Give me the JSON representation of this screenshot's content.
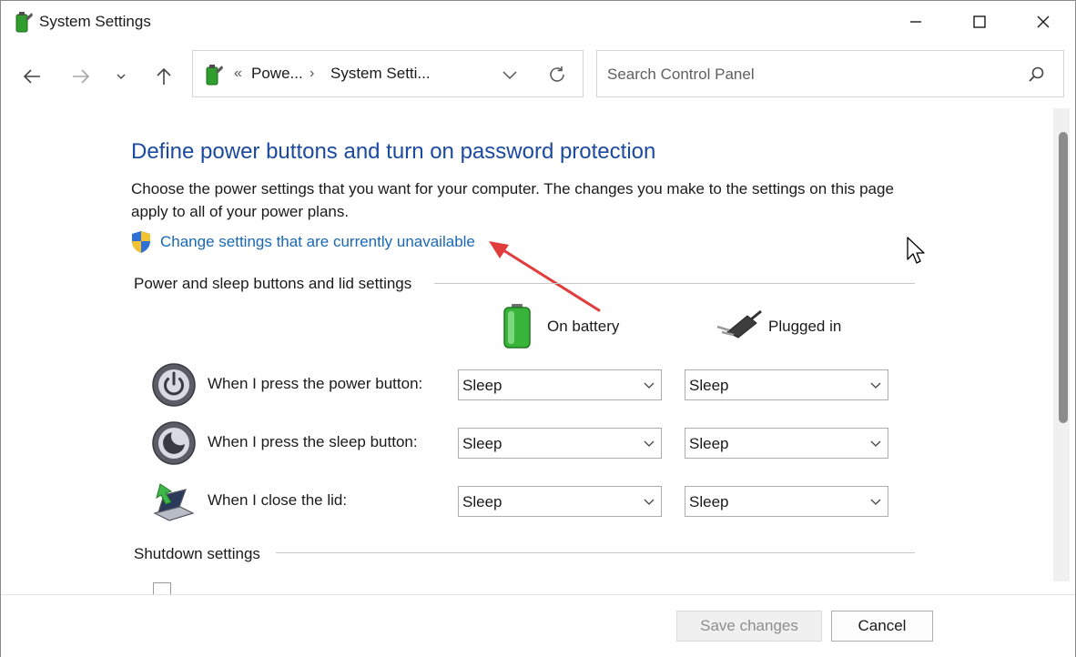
{
  "window": {
    "title": "System Settings"
  },
  "navigation": {
    "address": {
      "overflow": "«",
      "separator": "›",
      "crumbs": [
        "Powe...",
        "System Setti..."
      ]
    },
    "search": {
      "placeholder": "Search Control Panel"
    }
  },
  "main": {
    "heading": "Define power buttons and turn on password protection",
    "description": "Choose the power settings that you want for your computer. The changes you make to the settings on this page apply to all of your power plans.",
    "change_link": "Change settings that are currently unavailable",
    "power_section": {
      "title": "Power and sleep buttons and lid settings",
      "columns": [
        "On battery",
        "Plugged in"
      ],
      "rows": [
        {
          "label": "When I press the power button:",
          "icon": "power-button-icon",
          "on_battery": "Sleep",
          "plugged_in": "Sleep"
        },
        {
          "label": "When I press the sleep button:",
          "icon": "sleep-button-icon",
          "on_battery": "Sleep",
          "plugged_in": "Sleep"
        },
        {
          "label": "When I close the lid:",
          "icon": "laptop-lid-icon",
          "on_battery": "Sleep",
          "plugged_in": "Sleep"
        }
      ]
    },
    "shutdown_section": {
      "title": "Shutdown settings"
    }
  },
  "footer": {
    "save_label": "Save changes",
    "cancel_label": "Cancel"
  },
  "colors": {
    "heading": "#1b4aa0",
    "link": "#1968b8",
    "annotation_arrow": "#e03c3c"
  }
}
